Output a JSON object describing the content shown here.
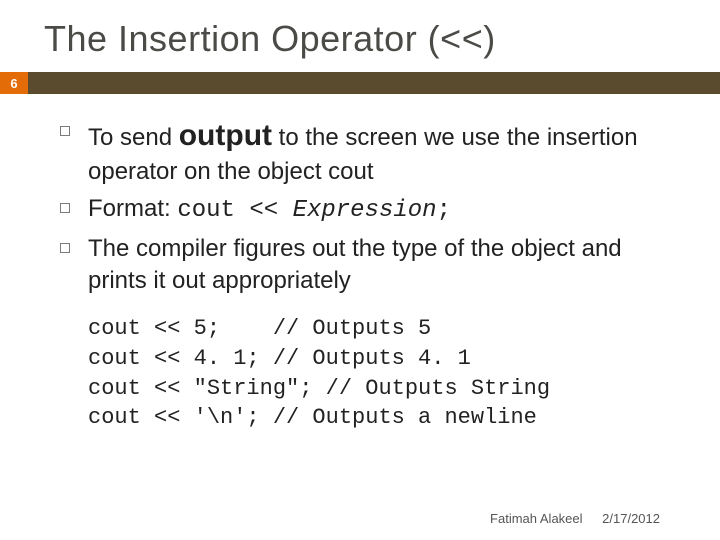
{
  "title": "The Insertion Operator (<<)",
  "page_number": "6",
  "bullets": {
    "b1_pre": "To send ",
    "b1_emph": "output",
    "b1_post": " to the screen we use the insertion operator on the object cout",
    "b2_pre": "Format: ",
    "b2_code": "cout << ",
    "b2_expr": "Expression",
    "b2_end": ";",
    "b3": "The compiler figures out the type of the object and prints it out appropriately"
  },
  "code": {
    "l1": "cout << 5;    // Outputs 5",
    "l2": "cout << 4. 1; // Outputs 4. 1",
    "l3": "cout << \"String\"; // Outputs String",
    "l4": "cout << '\\n'; // Outputs a newline"
  },
  "footer": {
    "author": "Fatimah Alakeel",
    "date": "2/17/2012"
  }
}
